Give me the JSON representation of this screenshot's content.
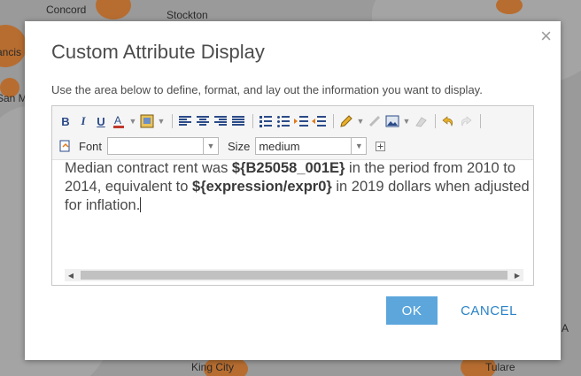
{
  "map": {
    "cities": [
      "Concord",
      "Stockton",
      "ancis",
      "San M",
      "King City",
      "Tulare",
      "A"
    ]
  },
  "dialog": {
    "title": "Custom Attribute Display",
    "description": "Use the area below to define, format, and lay out the information you want to display.",
    "close_glyph": "×",
    "toolbar": {
      "bold": "B",
      "italic": "I",
      "underline": "U",
      "font_label": "Font",
      "font_value": "",
      "size_label": "Size",
      "size_value": "medium"
    },
    "content": {
      "t1": "Median contract rent was ",
      "b1": "${B25058_001E}",
      "t2": " in the period from 2010 to 2014, equivalent to ",
      "b2": "${expression/expr0}",
      "t3": " in 2019 dollars when adjusted for inflation."
    },
    "ok_label": "OK",
    "cancel_label": "CANCEL"
  }
}
